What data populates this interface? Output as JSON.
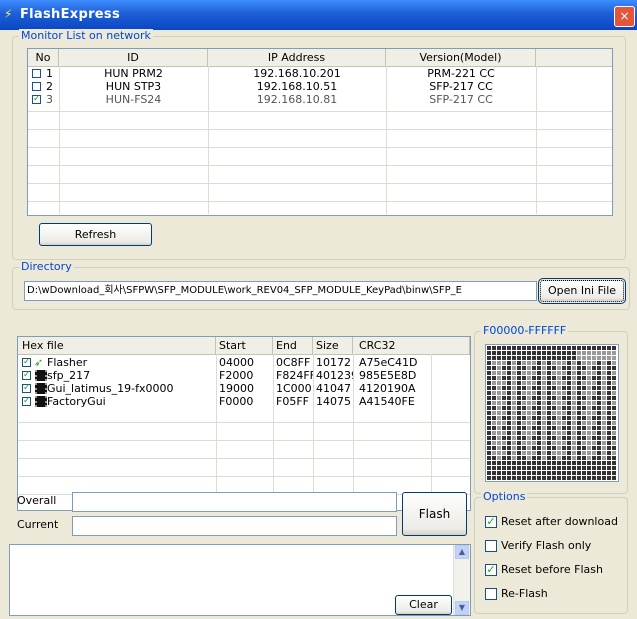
{
  "window": {
    "title": "FlashExpress",
    "close": "×"
  },
  "monitor": {
    "legend": "Monitor List on network",
    "columns": [
      "No",
      "ID",
      "IP Address",
      "Version(Model)"
    ],
    "rows": [
      {
        "no": "1",
        "id": "HUN PRM2",
        "ip": "192.168.10.201",
        "version": "PRM-221 CC",
        "checked": false
      },
      {
        "no": "2",
        "id": "HUN STP3",
        "ip": "192.168.10.51",
        "version": "SFP-217 CC",
        "checked": false
      },
      {
        "no": "3",
        "id": "HUN-FS24",
        "ip": "192.168.10.81",
        "version": "SFP-217 CC",
        "checked": true
      }
    ],
    "refresh_label": "Refresh"
  },
  "directory": {
    "legend": "Directory",
    "path": "D:\\wDownload_회사\\SFPW\\SFP_MODULE\\work_REV04_SFP_MODULE_KeyPad\\binw\\SFP_E",
    "open_button": "Open Ini File"
  },
  "hexfiles": {
    "columns": [
      "Hex file",
      "Start",
      "End",
      "Size",
      "CRC32"
    ],
    "rows": [
      {
        "name": "Flasher",
        "start": "04000",
        "end": "0C8FF",
        "size": "10172",
        "crc": "A75eC41D",
        "icon": "green-arrow-icon",
        "checked": true
      },
      {
        "name": "sfp_217",
        "start": "F2000",
        "end": "F824FF",
        "size": "401239",
        "crc": "985E5E8D",
        "icon": "chip-icon",
        "checked": true
      },
      {
        "name": "Gui_latimus_19-fx0000",
        "start": "19000",
        "end": "1C000",
        "size": "41047",
        "crc": "4120190A",
        "icon": "chip-icon",
        "checked": true
      },
      {
        "name": "FactoryGui",
        "start": "F0000",
        "end": "F05FF",
        "size": "14075",
        "crc": "A41540FE",
        "icon": "chip-icon",
        "checked": true
      }
    ]
  },
  "memory_map": {
    "legend": "F00000-FFFFFF"
  },
  "progress": {
    "overall_label": "Overall",
    "current_label": "Current",
    "flash_button": "Flash",
    "overall_value": 0,
    "current_value": 0
  },
  "log": {
    "clear_button": "Clear"
  },
  "options": {
    "legend": "Options",
    "items": [
      {
        "label": "Reset after download",
        "checked": true
      },
      {
        "label": "Verify Flash only",
        "checked": false
      },
      {
        "label": "Reset before Flash",
        "checked": true
      },
      {
        "label": "Re-Flash",
        "checked": false
      }
    ]
  },
  "colors": {
    "titlebar": "#0a46c4",
    "group_legend": "#0046d5",
    "check": "#21a121"
  }
}
